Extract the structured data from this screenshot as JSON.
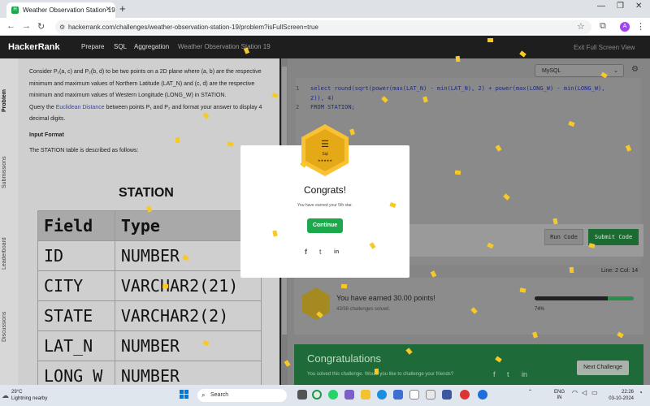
{
  "browser": {
    "tab_title": "Weather Observation Station 19",
    "url": "hackerrank.com/challenges/weather-observation-station-19/problem?isFullScreen=true",
    "profile_initial": "A"
  },
  "site_nav": {
    "logo": "HackerRank",
    "links": [
      "Prepare",
      "SQL",
      "Aggregation",
      "Weather Observation Station 19"
    ],
    "exit_label": "Exit Full Screen View"
  },
  "left_rail": [
    "Problem",
    "Submissions",
    "Leaderboard",
    "Discussions"
  ],
  "problem": {
    "p1": "Consider P₁(a, c) and P₂(b, d) to be two points on a 2D plane where (a, b) are the respective minimum and maximum values of Northern Latitude (LAT_N) and (c, d) are the respective minimum and maximum values of Western Longitude (LONG_W) in STATION.",
    "p2_pre": "Query the ",
    "p2_link": "Euclidean Distance",
    "p2_post": " between points P₁ and P₂ and format your answer to display 4 decimal digits.",
    "input_format": "Input Format",
    "described": "The STATION table is described as follows:",
    "table_title": "STATION",
    "table_headers": [
      "Field",
      "Type"
    ],
    "table_rows": [
      [
        "ID",
        "NUMBER"
      ],
      [
        "CITY",
        "VARCHAR2(21)"
      ],
      [
        "STATE",
        "VARCHAR2(2)"
      ],
      [
        "LAT_N",
        "NUMBER"
      ],
      [
        "LONG_W",
        "NUMBER"
      ]
    ]
  },
  "editor": {
    "language": "MySQL",
    "lines": [
      {
        "num": "1",
        "text": "select round(sqrt(power(max(LAT_N) - min(LAT_N), 2) + power(max(LONG_W) - min(LONG_W),"
      },
      {
        "num": "",
        "text": "2)), 4)"
      },
      {
        "num": "2",
        "text": "FROM STATION;"
      }
    ],
    "line_col": "Line: 2 Col: 14",
    "run_label": "Run Code",
    "submit_label": "Submit Code"
  },
  "result": {
    "points_text": "You have earned 30.00 points!",
    "challenges_text": "43/58 challenges solved.",
    "progress_pct": "74%",
    "progress_value": 0.74,
    "banner_title": "Congratulations",
    "banner_sub": "You solved this challenge. Would you like to challenge your friends?",
    "next_label": "Next Challenge"
  },
  "modal": {
    "badge_label": "Sql",
    "badge_stars": "★★★★★",
    "title": "Congrats!",
    "subtitle": "You have earned your 5th star.",
    "button": "Continue"
  },
  "taskbar": {
    "temp": "29°C",
    "weather": "Lightning nearby",
    "search_placeholder": "Search",
    "lang_top": "ENG",
    "lang_bottom": "IN",
    "time": "22:26",
    "date": "03-10-2024"
  },
  "colors": {
    "accent_green": "#1ba94c",
    "confetti": "#f7c928",
    "badge_gold": "#f8c234"
  }
}
